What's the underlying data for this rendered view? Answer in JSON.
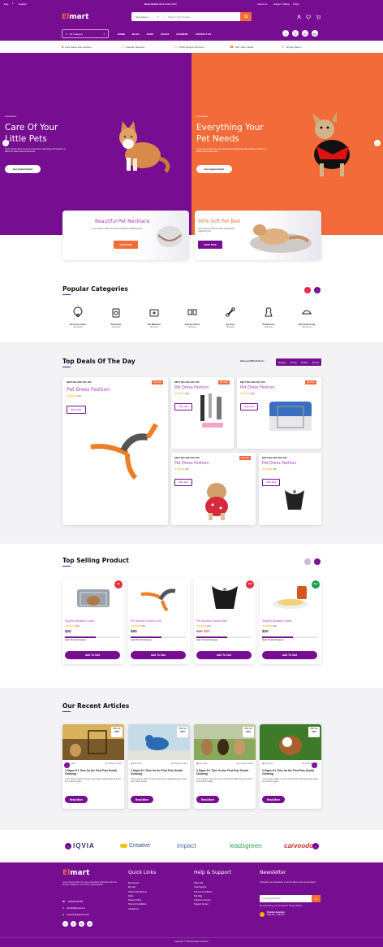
{
  "topbar": {
    "lang": "Eng",
    "currency": "English",
    "help_label": "Need Help?",
    "phone": "+0214-1023-2031",
    "links": [
      "About Us",
      "Gagerr Trailing",
      "FAQs"
    ]
  },
  "logo": {
    "first": "El",
    "second": "mart"
  },
  "search": {
    "category": "All Category",
    "placeholder": "Search Your Product"
  },
  "nav": {
    "categories_label": "All Category",
    "items": [
      "HOME",
      "BLOG",
      "SHOP",
      "PAGES",
      "ELEMENT",
      "CONTACT US"
    ]
  },
  "features": [
    "Free Same Day Delivery",
    "Friendly Services",
    "100% Secure Payment",
    "24/7 Help Center",
    "30 Day Return"
  ],
  "hero": [
    {
      "kicker": "Accessories",
      "title": "Care Of Your Little Pets",
      "desc": "Lorem ipsum dolor sit amet consectetur adipiscing elit tincidunt ut labore et dolore eiusmod tempor.",
      "cta": "Get Appointment"
    },
    {
      "kicker": "Accessories",
      "title": "Everything Your Pet Needs",
      "desc": "Lorem ipsum dolor sit amet consectetur adipiscing elit tincidunt ut labore et dolore eiusmod tempor.",
      "cta": "Get Appointment"
    }
  ],
  "promos": [
    {
      "title": "Beautiful Pet Necklace",
      "desc": "Lorem ipsum dolor sit amet consectetur adipiscing elit.",
      "cta": "SHOP NOW"
    },
    {
      "title": "90% Soft Pet Bed",
      "desc": "Lorem ipsum dolor sit amet consectetur adipiscing elit.",
      "cta": "SHOP NOW"
    }
  ],
  "categories": {
    "title": "Popular Categories",
    "items": [
      {
        "name": "Pet Accessories",
        "count": "(12 items)"
      },
      {
        "name": "Pet Foods",
        "count": "(6 items)"
      },
      {
        "name": "Pet Medicine",
        "count": "(8 items)"
      },
      {
        "name": "Fashion Shoes",
        "count": "(6 items)"
      },
      {
        "name": "Pet Toys",
        "count": "(8 items)"
      },
      {
        "name": "Pet Dresses",
        "count": "(8 items)"
      },
      {
        "name": "Pet Fashion-Cap",
        "count": "(15 items)"
      }
    ]
  },
  "deals": {
    "title": "Top Deals Of The Day",
    "timer_label": "Hurry up! Offer Ends In:",
    "days": "29 days",
    "hours": "22 Hrs",
    "mins": "50 Min",
    "secs": "45 Sec",
    "items": [
      {
        "badge": "BEST SELLING OFF 40%",
        "tag": "Hot Deal",
        "name": "Pet Dress Feshion",
        "rating": "(12)",
        "cta": "Shop Now"
      },
      {
        "badge": "BEST SELLING OFF 40%",
        "tag": "Hot Deal",
        "name": "Pet Dress Feshion",
        "rating": "(10)",
        "cta": "Shop Now"
      },
      {
        "badge": "BEST SELLING OFF 40%",
        "tag": "Hot Deal",
        "name": "Pet Dress Feshion",
        "rating": "(10)",
        "cta": "Shop Now"
      },
      {
        "badge": "BEST SELLING OFF 40%",
        "tag": "Hot Deal",
        "name": "Pet Dress Feshion",
        "rating": "(10)",
        "cta": "Shop Now"
      },
      {
        "badge": "BEST SELLING OFF 40%",
        "tag": "",
        "name": "Pet Dress Feshion",
        "rating": "(10)",
        "cta": "Shop Now"
      }
    ]
  },
  "top_selling": {
    "title": "Top Selling Product",
    "items": [
      {
        "badge": "Hot",
        "name": "Dog/Pet Beautiful Carrier",
        "rating": "(10)",
        "price": "$20",
        "sold": "Sold: 56 /100 Products",
        "progress": 0.56,
        "cta": "Add To Cart",
        "badge_color": "#e5303d"
      },
      {
        "badge": "",
        "name": "Pet Harness Comfort Line",
        "rating": "(10)",
        "price": "$50",
        "sold": "Sold: 56 /100 Products",
        "progress": 0.56,
        "cta": "Add To Cart",
        "badge_color": ""
      },
      {
        "badge": "-50%",
        "name": "Pet Harness Comfort Belt",
        "rating": "(10)",
        "price": "$50",
        "sold": "Sold: 56 /100 Products",
        "progress": 0.56,
        "cta": "Add To Cart",
        "badge_color": "#e5303d"
      },
      {
        "badge": "New",
        "name": "Dog/Pet Beautiful Carrier",
        "rating": "(10)",
        "price": "$20",
        "sold": "Sold: 56 /100 Products",
        "progress": 0.56,
        "cta": "Add To Cart",
        "badge_color": "#15a04a"
      }
    ]
  },
  "top_selling_oldprice": "$80",
  "top_selling_newprice": "$60",
  "articles": {
    "title": "Our Recent Articles",
    "items": [
      {
        "day": "20th Jan",
        "year": "2024",
        "cat": "Pet Care",
        "author": "By Khayron Islam",
        "title": "3 Signs It's Time for the First Pets Dental Cleaning",
        "desc": "Lorem ipsum dolor sit amet consectetur adipiscing elit. Enim nec mauris fugiat.",
        "cta": "Read More"
      },
      {
        "day": "20th Jan",
        "year": "2024",
        "cat": "Pet Care",
        "author": "By Khayron Islam",
        "title": "3 Signs It's Time for the First Pets Dental Cleaning",
        "desc": "Lorem ipsum dolor sit amet consectetur adipiscing elit. Enim nec mauris fugiat.",
        "cta": "Read More"
      },
      {
        "day": "20th Jan",
        "year": "2024",
        "cat": "Pet Care",
        "author": "By Khayron Islam",
        "title": "3 Signs It's Time for the First Pets Dental Cleaning",
        "desc": "Lorem ipsum dolor sit amet consectetur adipiscing elit. Enim nec mauris fugiat.",
        "cta": "Read More"
      },
      {
        "day": "20th Jan",
        "year": "2024",
        "cat": "Pet Care",
        "author": "By Khayron Islam",
        "title": "3 Signs It's Time for the First Pets Dental Cleaning",
        "desc": "Lorem ipsum dolor sit amet consectetur adipiscing elit. Enim nec mauris fugiat.",
        "cta": "Read More"
      }
    ]
  },
  "brands": [
    "IQVIA",
    "Creative",
    "impact",
    "leadsgreen",
    "carvoodoo"
  ],
  "footer": {
    "about": "Lorem ipsum dolor sit amet consectetur adipiscing elit sed tempor incididunt, enim dolor magna aliqua.",
    "phone": "+00236 365 658",
    "email": "abc123@gmail.com",
    "web": "www.elmartpetcare.com",
    "quick_title": "Quick Links",
    "quick": [
      "My Account",
      "My Cart",
      "Orders and Returns",
      "FAQs",
      "Privacy Policy",
      "Terms & Conditions",
      "Contact Us"
    ],
    "help_title": "Help & Support",
    "help": [
      "Store Info",
      "Chat Support",
      "Terms & Conditions",
      "Site Map",
      "Customer Service",
      "Support Center"
    ],
    "news_title": "Newsletter",
    "news_desc": "Subscribe our Newsletter to get the latest news and insights.",
    "news_placeholder": "Your Email Address",
    "news_agree": "By subscribing, you accept the Privacy Policy",
    "hours_title": "Monday-Saturday",
    "hours": "9:00 Am - 4:00 Pm",
    "copyright": "Copyright © 2024 All rights reserved."
  },
  "colors": {
    "purple": "#770e92",
    "orange": "#f26b38"
  }
}
